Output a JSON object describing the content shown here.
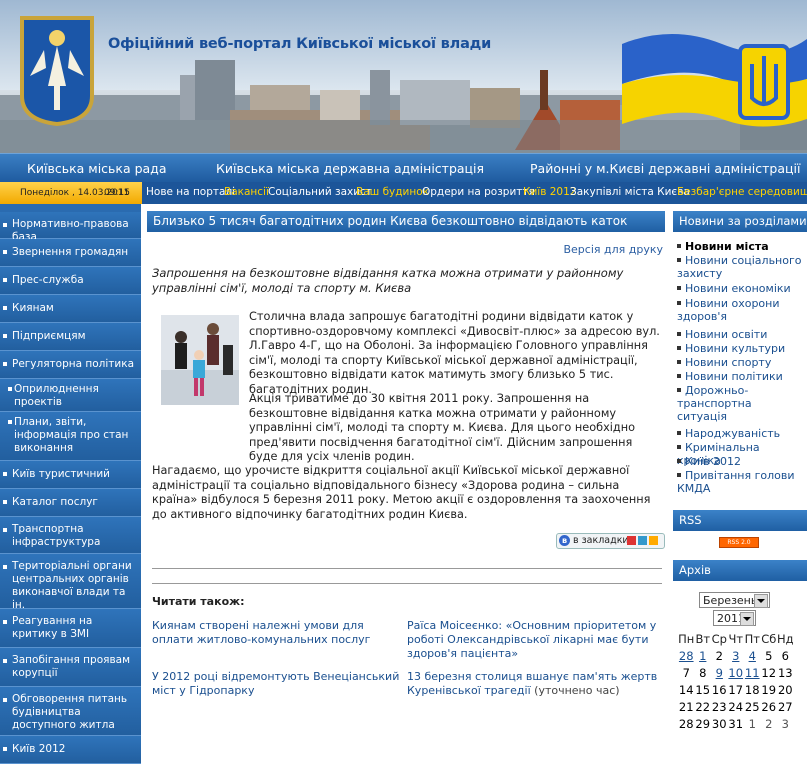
{
  "header": {
    "title": "Офіційний веб-портал Київської міської влади"
  },
  "topnav": [
    "Київська міська рада",
    "Київська міська державна адміністрація",
    "Районні у м.Києві державні адміністрації"
  ],
  "datebar": {
    "date": "Понеділок , 14.03.2011",
    "time": "09:15"
  },
  "subnav": [
    "Нове на порталі",
    "Вакансії",
    "Соціальний захист",
    "Ваш будинок",
    "Ордери на розриття",
    "Київ 2012",
    "Закупівлі міста Києва",
    "Безбар'єрне середовище"
  ],
  "sidebar": [
    "Нормативно-правова база",
    "Звернення громадян",
    "Прес-служба",
    "Киянам",
    "Підприємцям",
    "Регуляторна політика",
    "Оприлюднення проектів",
    "Плани, звіти, інформація про стан виконання",
    "Київ туристичний",
    "Каталог послуг",
    "Транспортна інфраструктура",
    "Територіальні органи центральних органів виконавчої влади та ін.",
    "Реагування на критику в ЗМІ",
    "Запобігання проявам корупції",
    "Обговорення питань будівництва доступного житла",
    "Київ 2012"
  ],
  "article": {
    "title": "Близько 5 тисяч багатодітних родин Києва безкоштовно відвідають каток",
    "print_link": "Версія для друку",
    "lead": "Запрошення на безкоштовне відвідання катка можна отримати у районному управлінні сім'ї, молоді та спорту м. Києва",
    "p1": "Столична влада запрошує багатодітні родини відвідати каток у спортивно-оздоровчому комплексі «Дивосвіт-плюс» за адресою вул. Л.Гавро 4-Г, що на Оболоні. За інформацією Головного управління сім'ї, молоді та спорту Київської міської державної адміністрації, безкоштовно відвідати каток матимуть змогу близько 5 тис. багатодітних родин.",
    "p2": "Акція триватиме до 30 квітня 2011 року. Запрошення на безкоштовне відвідання катка можна отримати у районному управлінні сім'ї, молоді та спорту м. Києва. Для цього необхідно пред'явити посвідчення багатодітної сім'ї. Дійсним запрошення буде для усіх членів родин.",
    "p3": "Нагадаємо, що урочисте відкриття соціальної акції Київської міської державної адміністрації та соціально відповідального бізнесу «Здорова родина – сильна країна» відбулося 5 березня 2011 року. Метою акції є оздоровлення та заохочення до активного відпочинку багатодітних родин Києва.",
    "bookmarks_label": "в закладки"
  },
  "read_also": {
    "heading": "Читати також:",
    "items": [
      {
        "text": "Киянам створені належні умови для оплати житлово-комунальних послуг",
        "note": ""
      },
      {
        "text": "Раїса Моісеєнко: «Основним пріоритетом у роботі Олександрівської лікарні має бути здоров'я пацієнта»",
        "note": ""
      },
      {
        "text": "У 2012 році відремонтують Венеціанський міст у Гідропарку",
        "note": ""
      },
      {
        "text": "13 березня столиця вшанує пам'ять жертв Куренівської трагедії",
        "note": "(уточнено час)"
      }
    ]
  },
  "right": {
    "news_heading": "Новини за розділами",
    "news_sections": [
      "Новини міста",
      "Новини соціального захисту",
      "Новини економіки",
      "Новини охорони здоров'я",
      "Новини освіти",
      "Новини культури",
      "Новини спорту",
      "Новини політики",
      "Дорожньо-транспортна ситуація",
      "Народжуваність",
      "Кримінальна хроніка",
      "Київ 2012",
      "Привітання голови КМДА"
    ],
    "rss_heading": "RSS",
    "rss_button": "RSS 2.0",
    "archive_heading": "Архів",
    "month": "Березень",
    "year": "2011",
    "weekdays": [
      "Пн",
      "Вт",
      "Ср",
      "Чт",
      "Пт",
      "Сб",
      "Нд"
    ],
    "weeks": [
      [
        "28",
        "1",
        "2",
        "3",
        "4",
        "5",
        "6"
      ],
      [
        "7",
        "8",
        "9",
        "10",
        "11",
        "12",
        "13"
      ],
      [
        "14",
        "15",
        "16",
        "17",
        "18",
        "19",
        "20"
      ],
      [
        "21",
        "22",
        "23",
        "24",
        "25",
        "26",
        "27"
      ],
      [
        "28",
        "29",
        "30",
        "31",
        "1",
        "2",
        "3"
      ]
    ]
  },
  "colors": {
    "nav_blue": "#1f5b9f",
    "accent_yellow": "#ffd200",
    "link": "#1a4f8f"
  }
}
